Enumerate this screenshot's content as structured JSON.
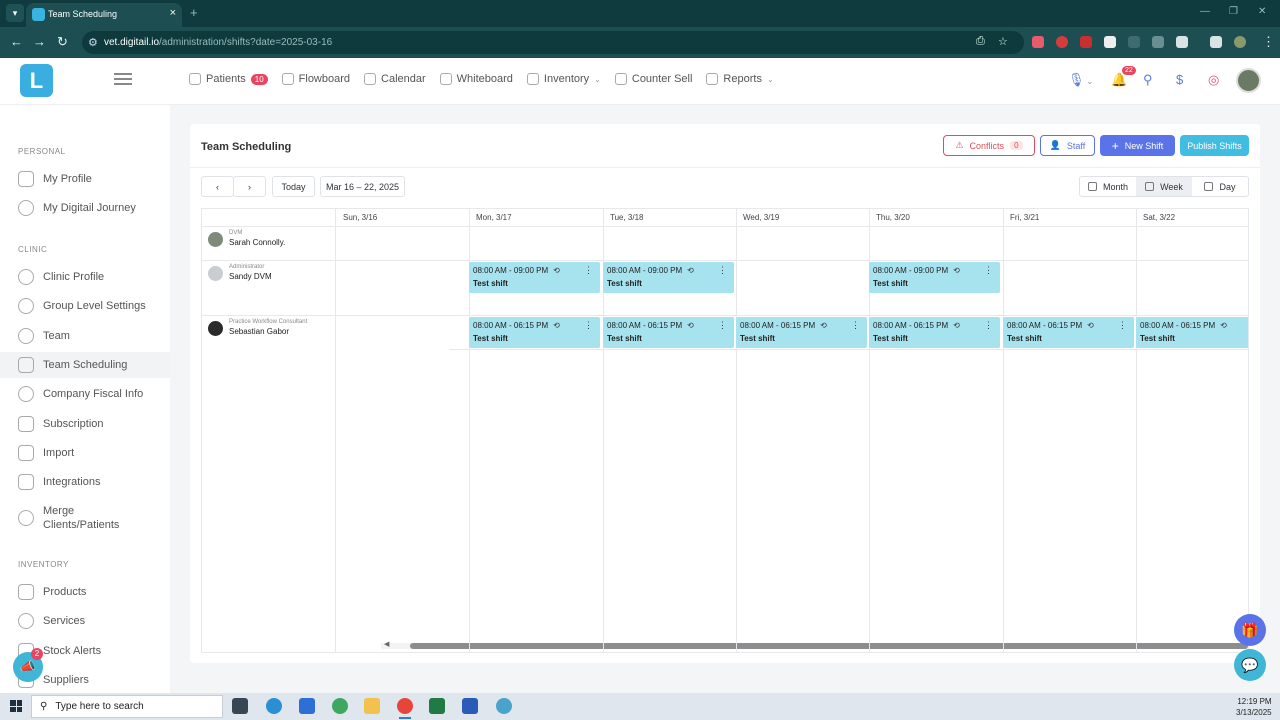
{
  "browser": {
    "tab_title": "Team Scheduling",
    "url_host": "vet.digitail.io",
    "url_path": "/administration/shifts?date=2025-03-16"
  },
  "app": {
    "logo_letter": "L",
    "nav": [
      {
        "label": "Patients",
        "badge": "10",
        "icon": "paw-icon"
      },
      {
        "label": "Flowboard",
        "icon": "flowboard-icon"
      },
      {
        "label": "Calendar",
        "icon": "calendar-icon"
      },
      {
        "label": "Whiteboard",
        "icon": "whiteboard-icon"
      },
      {
        "label": "Inventory",
        "icon": "inventory-icon",
        "dropdown": true
      },
      {
        "label": "Counter Sell",
        "icon": "counter-sell-icon"
      },
      {
        "label": "Reports",
        "icon": "reports-icon",
        "dropdown": true
      }
    ],
    "notifications_count": "22"
  },
  "sidebar": {
    "personal_label": "PERSONAL",
    "personal": [
      "My Profile",
      "My Digitail Journey"
    ],
    "clinic_label": "CLINIC",
    "clinic": [
      "Clinic Profile",
      "Group Level Settings",
      "Team",
      "Team Scheduling",
      "Company Fiscal Info",
      "Subscription",
      "Import",
      "Integrations",
      "Merge Clients/Patients"
    ],
    "inventory_label": "INVENTORY",
    "inventory": [
      "Products",
      "Services",
      "Stock Alerts",
      "Suppliers"
    ],
    "announce_badge": "2"
  },
  "scheduling": {
    "title": "Team Scheduling",
    "conflicts_label": "Conflicts",
    "conflicts_count": "0",
    "staff_label": "Staff",
    "new_shift_label": "New Shift",
    "publish_label": "Publish Shifts",
    "today_label": "Today",
    "date_range": "Mar 16 – 22, 2025",
    "views": [
      "Month",
      "Week",
      "Day"
    ],
    "active_view": "Week",
    "days": [
      "Sun, 3/16",
      "Mon, 3/17",
      "Tue, 3/18",
      "Wed, 3/19",
      "Thu, 3/20",
      "Fri, 3/21",
      "Sat, 3/22"
    ],
    "employees": [
      {
        "role": "DVM",
        "name": "Sarah Connolly."
      },
      {
        "role": "Administrator",
        "name": "Sandy DVM"
      },
      {
        "role": "Practice Workflow Consultant",
        "name": "Sebastian Gabor"
      }
    ],
    "shifts": [
      {
        "employee": 1,
        "day": 1,
        "time": "08:00 AM - 09:00 PM",
        "name": "Test shift"
      },
      {
        "employee": 1,
        "day": 2,
        "time": "08:00 AM - 09:00 PM",
        "name": "Test shift"
      },
      {
        "employee": 1,
        "day": 4,
        "time": "08:00 AM - 09:00 PM",
        "name": "Test shift"
      },
      {
        "employee": 2,
        "day": 1,
        "time": "08:00 AM - 06:15 PM",
        "name": "Test shift"
      },
      {
        "employee": 2,
        "day": 2,
        "time": "08:00 AM - 06:15 PM",
        "name": "Test shift"
      },
      {
        "employee": 2,
        "day": 3,
        "time": "08:00 AM - 06:15 PM",
        "name": "Test shift"
      },
      {
        "employee": 2,
        "day": 4,
        "time": "08:00 AM - 06:15 PM",
        "name": "Test shift"
      },
      {
        "employee": 2,
        "day": 5,
        "time": "08:00 AM - 06:15 PM",
        "name": "Test shift"
      },
      {
        "employee": 2,
        "day": 6,
        "time": "08:00 AM - 06:15 PM",
        "name": "Test shift"
      }
    ]
  },
  "taskbar": {
    "search_placeholder": "Type here to search",
    "time": "12:19 PM",
    "date": "3/13/2025"
  },
  "colors": {
    "accent": "#5a73e8",
    "shift_bg": "#a6e3ef",
    "conflict": "#e34b5a",
    "brand": "#3aaee0"
  }
}
